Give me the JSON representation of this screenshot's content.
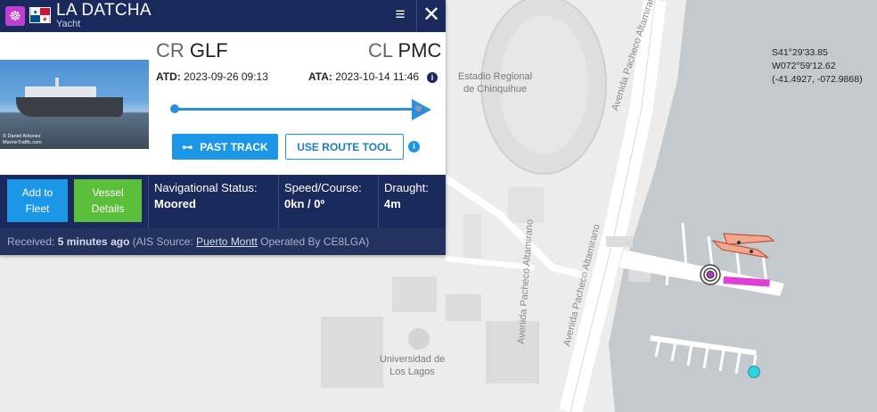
{
  "header": {
    "vessel_name": "LA DATCHA",
    "vessel_type": "Yacht",
    "ship_icon": "ship-wheel-icon",
    "flag_icon": "panama-flag-icon",
    "menu_icon": "hamburger-menu-icon",
    "close_icon": "close-icon"
  },
  "photo": {
    "credit_line1": "© Daniel Antunez",
    "credit_line2": "MarineTraffic.com"
  },
  "voyage": {
    "departure_country": "CR",
    "departure_port": "GLF",
    "arrival_country": "CL",
    "arrival_port": "PMC",
    "atd_label": "ATD:",
    "atd_value": "2023-09-26 09:13",
    "ata_label": "ATA:",
    "ata_value": "2023-10-14 11:46",
    "progress": 1.0
  },
  "actions": {
    "past_track": "PAST TRACK",
    "route_tool": "USE ROUTE TOOL"
  },
  "stats": {
    "add_to_fleet": "Add to Fleet",
    "vessel_details": "Vessel Details",
    "nav_status_label": "Navigational Status:",
    "nav_status_value": "Moored",
    "speed_label": "Speed/Course:",
    "speed_value": "0kn / 0º",
    "draught_label": "Draught:",
    "draught_value": "4m"
  },
  "footer": {
    "received_label": "Received:",
    "received_value": "5 minutes ago",
    "ais_prefix": "(AIS Source:",
    "ais_source": "Puerto Montt",
    "ais_suffix": "Operated By CE8LGA)"
  },
  "map": {
    "stadium_label": "Estadio Regional de Chinquihue",
    "road_1": "Avenida Pacheco Altamirano",
    "road_2": "Avenida Pacheco Altamirano",
    "road_3": "Avenida Pacheco Altamirano",
    "university_label": "Universidad de Los Lagos",
    "coords_lat": "S41°29'33.85",
    "coords_lon": "W072°59'12.62",
    "coords_decimal": "(-41.4927, -072.9868)",
    "colors": {
      "land": "#ececec",
      "water": "#c4c9cd",
      "road": "#ffffff",
      "pier": "#ffffff",
      "vessel_pink": "#e040d8",
      "marker_cyan": "#2fd0e0"
    }
  }
}
